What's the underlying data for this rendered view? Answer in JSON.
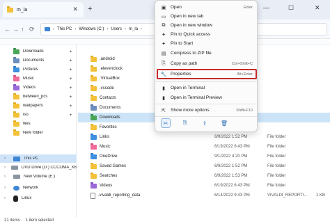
{
  "window": {
    "tab_title": "m_la",
    "tab_close": "✕",
    "new_tab": "+",
    "minimize": "—",
    "maximize": "☐",
    "close": "✕"
  },
  "nav": {
    "back": "←",
    "forward": "→",
    "up": "↑",
    "refresh": "⟳",
    "breadcrumb": [
      "This PC",
      "Windows (C:)",
      "Users",
      "m_la"
    ]
  },
  "sidebar": {
    "items": [
      {
        "label": "Downloads",
        "icon": "downloads-folder-icon",
        "pinned": true
      },
      {
        "label": "Documents",
        "icon": "documents-folder-icon",
        "pinned": true
      },
      {
        "label": "Pictures",
        "icon": "pictures-folder-icon",
        "pinned": true
      },
      {
        "label": "Music",
        "icon": "music-folder-icon",
        "pinned": true
      },
      {
        "label": "Videos",
        "icon": "videos-folder-icon",
        "pinned": true
      },
      {
        "label": "between_pcs",
        "icon": "folder-icon",
        "pinned": true
      },
      {
        "label": "wallpapers",
        "icon": "folder-icon",
        "pinned": true
      },
      {
        "label": "iso",
        "icon": "folder-icon",
        "pinned": true
      },
      {
        "label": "files",
        "icon": "folder-icon",
        "pinned": false
      },
      {
        "label": "New folder",
        "icon": "folder-icon",
        "pinned": false
      }
    ],
    "drives": [
      {
        "label": "This PC",
        "icon": "this-pc-icon",
        "selected": true
      },
      {
        "label": "DVD Drive (D:) CCCOMA_X64FRE_E",
        "icon": "dvd-drive-icon",
        "selected": false
      },
      {
        "label": "New Volume (E:)",
        "icon": "drive-icon",
        "selected": false
      },
      {
        "label": "Network",
        "icon": "network-icon",
        "selected": false
      },
      {
        "label": "Linux",
        "icon": "linux-icon",
        "selected": false
      }
    ]
  },
  "files": [
    {
      "name": ".android",
      "date": "",
      "type": "",
      "size": "",
      "icon": "folder"
    },
    {
      "name": ".elevenclock",
      "date": "",
      "type": "",
      "size": "",
      "icon": "folder"
    },
    {
      "name": ".VirtualBox",
      "date": "",
      "type": "",
      "size": "",
      "icon": "folder"
    },
    {
      "name": ".vscode",
      "date": "",
      "type": "",
      "size": "",
      "icon": "folder"
    },
    {
      "name": "Contacts",
      "date": "",
      "type": "",
      "size": "",
      "icon": "folder"
    },
    {
      "name": "Documents",
      "date": "",
      "type": "",
      "size": "",
      "icon": "doc"
    },
    {
      "name": "Downloads",
      "date": "",
      "type": "",
      "size": "",
      "icon": "green",
      "selected": true
    },
    {
      "name": "Favorites",
      "date": "",
      "type": "",
      "size": "",
      "icon": "folder"
    },
    {
      "name": "Links",
      "date": "6/9/2022 1:52 PM",
      "type": "File folder",
      "size": "",
      "icon": "folder"
    },
    {
      "name": "Music",
      "date": "6/19/2022 6:43 PM",
      "type": "File folder",
      "size": "",
      "icon": "pink"
    },
    {
      "name": "OneDrive",
      "date": "9/1/2022 4:20 PM",
      "type": "File folder",
      "size": "",
      "icon": "blue"
    },
    {
      "name": "Saved Games",
      "date": "6/9/2022 1:52 PM",
      "type": "File folder",
      "size": "",
      "icon": "folder"
    },
    {
      "name": "Searches",
      "date": "6/9/2022 1:53 PM",
      "type": "File folder",
      "size": "",
      "icon": "folder"
    },
    {
      "name": "Videos",
      "date": "6/19/2022 6:43 PM",
      "type": "File folder",
      "size": "",
      "icon": "purple"
    },
    {
      "name": ".vivaldi_reporting_data",
      "date": "6/14/2022 9:43 PM",
      "type": "VIVALDI_REPORTI...",
      "size": "1 KB",
      "icon": "file"
    }
  ],
  "status": {
    "items": "21 items",
    "selected": "1 item selected"
  },
  "context_menu": {
    "items": [
      {
        "label": "Open",
        "shortcut": "Enter",
        "icon": "open-icon",
        "glyph": "▣"
      },
      {
        "label": "Open in new tab",
        "shortcut": "",
        "icon": "new-tab-icon",
        "glyph": "▭"
      },
      {
        "label": "Open in new window",
        "shortcut": "",
        "icon": "new-window-icon",
        "glyph": "⧉"
      },
      {
        "label": "Pin to Quick access",
        "shortcut": "",
        "icon": "pin-icon",
        "glyph": "✦"
      },
      {
        "label": "Pin to Start",
        "shortcut": "",
        "icon": "pin-start-icon",
        "glyph": "✦"
      },
      {
        "label": "Compress to ZIP file",
        "shortcut": "",
        "icon": "zip-icon",
        "glyph": "▤"
      },
      {
        "label": "Copy as path",
        "shortcut": "Ctrl+Shift+C",
        "icon": "copy-path-icon",
        "glyph": "⎘"
      },
      {
        "label": "Properties",
        "shortcut": "Alt+Enter",
        "icon": "properties-icon",
        "glyph": "🔧",
        "highlight": true
      },
      {
        "label": "Open in Terminal",
        "shortcut": "",
        "icon": "terminal-icon",
        "glyph": "▮"
      },
      {
        "label": "Open in Terminal Preview",
        "shortcut": "",
        "icon": "terminal-preview-icon",
        "glyph": "▮"
      },
      {
        "label": "Show more options",
        "shortcut": "Shift+F10",
        "icon": "more-options-icon",
        "glyph": "⇱"
      }
    ],
    "bottom_actions": [
      {
        "name": "cut",
        "glyph": "✂",
        "icon": "cut-icon"
      },
      {
        "name": "copy",
        "glyph": "⎘",
        "icon": "copy-icon"
      },
      {
        "name": "share",
        "glyph": "⇪",
        "icon": "share-icon"
      },
      {
        "name": "delete",
        "glyph": "🗑",
        "icon": "delete-icon"
      }
    ]
  },
  "colors": {
    "accent": "#2d6db3",
    "highlight_border": "#c62b2b",
    "selection": "#cce4f7"
  }
}
